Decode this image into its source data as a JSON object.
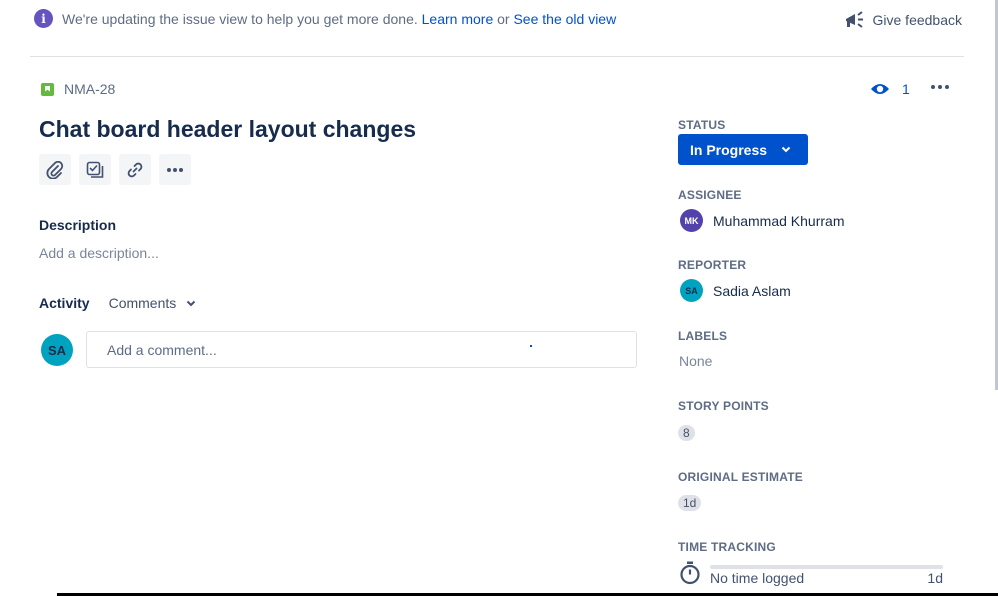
{
  "banner": {
    "message": "We're updating the issue view to help you get more done.",
    "learn_more": "Learn more",
    "or": "or",
    "old_view": "See the old view",
    "feedback": "Give feedback"
  },
  "issue": {
    "key": "NMA-28",
    "title": "Chat board header layout changes",
    "watchers": "1"
  },
  "description": {
    "heading": "Description",
    "placeholder": "Add a description..."
  },
  "activity": {
    "label": "Activity",
    "filter": "Comments",
    "commenter_initials": "SA",
    "comment_placeholder": "Add a comment..."
  },
  "fields": {
    "status_label": "STATUS",
    "status_value": "In Progress",
    "assignee_label": "ASSIGNEE",
    "assignee_initials": "MK",
    "assignee_name": "Muhammad Khurram",
    "reporter_label": "REPORTER",
    "reporter_initials": "SA",
    "reporter_name": "Sadia Aslam",
    "labels_label": "LABELS",
    "labels_value": "None",
    "story_points_label": "STORY POINTS",
    "story_points_value": "8",
    "original_estimate_label": "ORIGINAL ESTIMATE",
    "original_estimate_value": "1d",
    "time_tracking_label": "TIME TRACKING",
    "time_logged": "No time logged",
    "time_estimate": "1d"
  },
  "colors": {
    "primary": "#0052cc",
    "story_green": "#63ba3c",
    "info_purple": "#6554c0",
    "avatar_teal": "#00a3bf",
    "avatar_purple": "#5243aa"
  }
}
